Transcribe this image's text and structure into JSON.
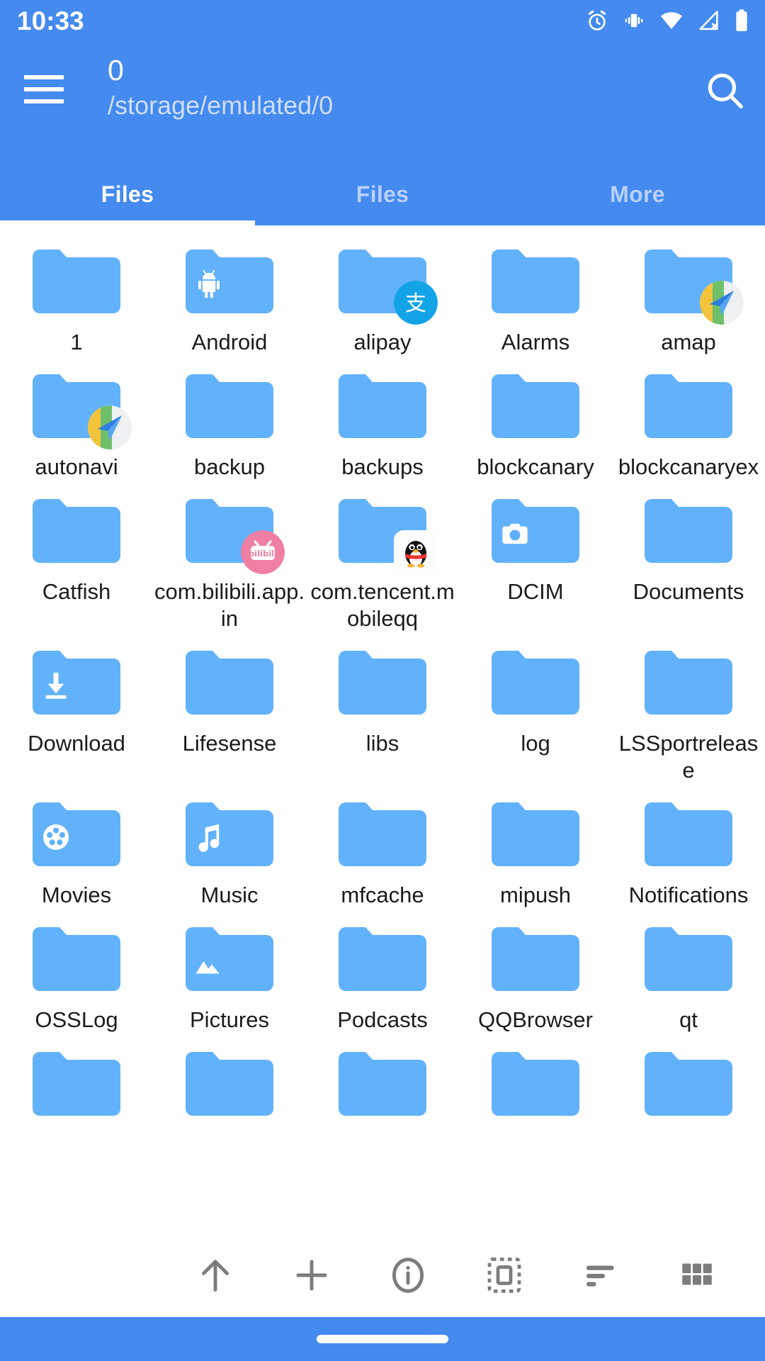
{
  "status_bar": {
    "time": "10:33",
    "icons": [
      "alarm-icon",
      "vibrate-icon",
      "wifi-icon",
      "no-cellular-signal-icon",
      "battery-icon"
    ]
  },
  "app_bar": {
    "menu_icon": "hamburger-menu-icon",
    "title": "0",
    "subtitle": "/storage/emulated/0",
    "search_icon": "search-icon",
    "accent_color": "#448aef"
  },
  "tabs": [
    {
      "label": "Files",
      "active": true
    },
    {
      "label": "Files",
      "active": false
    },
    {
      "label": "More",
      "active": false
    }
  ],
  "files": [
    {
      "name": "1",
      "icon": "folder-plain"
    },
    {
      "name": "Android",
      "icon": "folder-android"
    },
    {
      "name": "alipay",
      "icon": "folder-plain",
      "badge": "alipay-badge"
    },
    {
      "name": "Alarms",
      "icon": "folder-plain"
    },
    {
      "name": "amap",
      "icon": "folder-plain",
      "badge": "amap-badge"
    },
    {
      "name": "autonavi",
      "icon": "folder-plain",
      "badge": "amap-badge"
    },
    {
      "name": "backup",
      "icon": "folder-plain"
    },
    {
      "name": "backups",
      "icon": "folder-plain"
    },
    {
      "name": "blockcanary",
      "icon": "folder-plain"
    },
    {
      "name": "blockcanaryex",
      "icon": "folder-plain"
    },
    {
      "name": "Catfish",
      "icon": "folder-plain"
    },
    {
      "name": "com.bilibili.app.in",
      "icon": "folder-plain",
      "badge": "bilibili-badge"
    },
    {
      "name": "com.tencent.mobileqq",
      "icon": "folder-plain",
      "badge": "qq-badge"
    },
    {
      "name": "DCIM",
      "icon": "folder-camera"
    },
    {
      "name": "Documents",
      "icon": "folder-plain"
    },
    {
      "name": "Download",
      "icon": "folder-download"
    },
    {
      "name": "Lifesense",
      "icon": "folder-plain"
    },
    {
      "name": "libs",
      "icon": "folder-plain"
    },
    {
      "name": "log",
      "icon": "folder-plain"
    },
    {
      "name": "LSSportrelease",
      "icon": "folder-plain"
    },
    {
      "name": "Movies",
      "icon": "folder-movies"
    },
    {
      "name": "Music",
      "icon": "folder-music"
    },
    {
      "name": "mfcache",
      "icon": "folder-plain"
    },
    {
      "name": "mipush",
      "icon": "folder-plain"
    },
    {
      "name": "Notifications",
      "icon": "folder-plain"
    },
    {
      "name": "OSSLog",
      "icon": "folder-plain"
    },
    {
      "name": "Pictures",
      "icon": "folder-pictures"
    },
    {
      "name": "Podcasts",
      "icon": "folder-plain"
    },
    {
      "name": "QQBrowser",
      "icon": "folder-plain"
    },
    {
      "name": "qt",
      "icon": "folder-plain"
    },
    {
      "name": "",
      "icon": "folder-plain"
    },
    {
      "name": "",
      "icon": "folder-plain"
    },
    {
      "name": "",
      "icon": "folder-plain"
    },
    {
      "name": "",
      "icon": "folder-plain"
    },
    {
      "name": "",
      "icon": "folder-plain"
    }
  ],
  "toolbar": [
    {
      "icon": "up-arrow-icon",
      "label": "Go up"
    },
    {
      "icon": "plus-icon",
      "label": "New"
    },
    {
      "icon": "info-icon",
      "label": "Info"
    },
    {
      "icon": "select-all-icon",
      "label": "Select"
    },
    {
      "icon": "sort-icon",
      "label": "Sort"
    },
    {
      "icon": "grid-view-icon",
      "label": "View"
    }
  ],
  "nav_bar": {
    "gesture_pill": "home-gesture-pill"
  },
  "colors": {
    "app_bar": "#448aef",
    "folder": "#61b2fb",
    "folder_dark": "#4aa5f7",
    "text": "#1b1b1b",
    "tab_inactive": "#b9d1f9",
    "toolbar_icon": "#7c7c7c"
  }
}
